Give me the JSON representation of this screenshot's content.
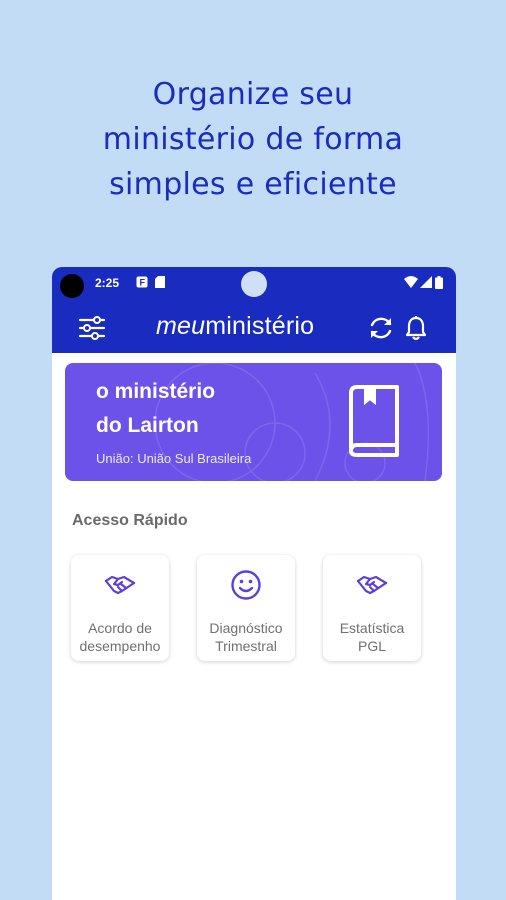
{
  "headline": {
    "line1": "Organize seu",
    "line2": "ministério de forma",
    "line3": "simples e eficiente"
  },
  "status_bar": {
    "time": "2:25"
  },
  "app_bar": {
    "brand_light": "meu",
    "brand_bold": "ministério"
  },
  "ministry_card": {
    "title_line1": "o ministério",
    "title_line2": "do Lairton",
    "union": "União: União Sul Brasileira"
  },
  "quick_access": {
    "title": "Acesso Rápido",
    "items": [
      {
        "line1": "Acordo de",
        "line2": "desempenho",
        "icon": "handshake-icon"
      },
      {
        "line1": "Diagnóstico",
        "line2": "Trimestral",
        "icon": "smiley-icon"
      },
      {
        "line1": "Estatística",
        "line2": "PGL",
        "icon": "handshake-icon"
      }
    ]
  },
  "colors": {
    "background": "#c2dcf5",
    "primary": "#1a2bbf",
    "card": "#6d52ea",
    "icon_accent": "#5b3fe0"
  }
}
